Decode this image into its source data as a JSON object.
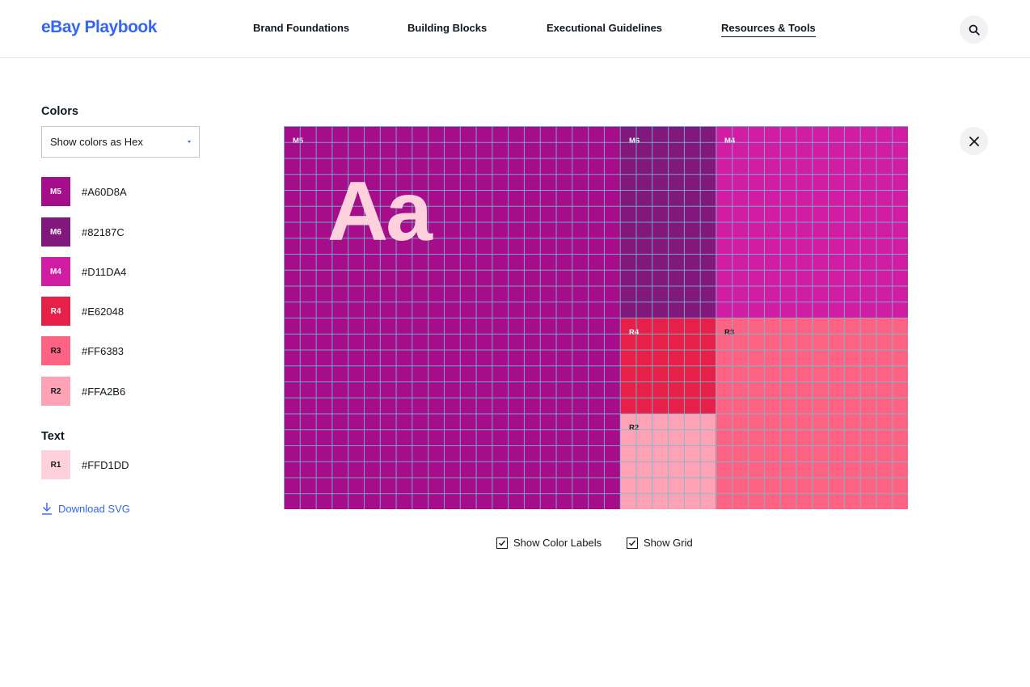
{
  "header": {
    "logo": "eBay Playbook",
    "nav": [
      "Brand Foundations",
      "Building Blocks",
      "Executional Guidelines",
      "Resources & Tools"
    ],
    "active_nav": "Resources & Tools",
    "search_icon": "search-icon"
  },
  "sidebar": {
    "colors_title": "Colors",
    "select_value": "Show colors as Hex",
    "swatches": [
      {
        "code": "M5",
        "hex": "#A60D8A",
        "label_color": "#ffffff"
      },
      {
        "code": "M6",
        "hex": "#82187C",
        "label_color": "#ffffff"
      },
      {
        "code": "M4",
        "hex": "#D11DA4",
        "label_color": "#ffffff"
      },
      {
        "code": "R4",
        "hex": "#E62048",
        "label_color": "#ffffff"
      },
      {
        "code": "R3",
        "hex": "#FF6383",
        "label_color": "#111820"
      },
      {
        "code": "R2",
        "hex": "#FFA2B6",
        "label_color": "#111820"
      }
    ],
    "text_title": "Text",
    "text_swatch": {
      "code": "R1",
      "hex": "#FFD1DD",
      "label_color": "#111820"
    },
    "download_label": "Download SVG"
  },
  "canvas": {
    "sample_text": "Aa",
    "blocks": [
      {
        "label": "M5",
        "color": "#A60D8A",
        "label_color": "#ffffff"
      },
      {
        "label": "M6",
        "color": "#82187C",
        "label_color": "#ffffff"
      },
      {
        "label": "M4",
        "color": "#D11DA4",
        "label_color": "#ffffff"
      },
      {
        "label": "R4",
        "color": "#E62048",
        "label_color": "#ffffff"
      },
      {
        "label": "R3",
        "color": "#FF6383",
        "label_color": "#111820"
      },
      {
        "label": "R2",
        "color": "#FFA2B6",
        "label_color": "#111820"
      }
    ],
    "grid_color": "#6EBED2"
  },
  "options": {
    "show_labels": "Show Color Labels",
    "show_labels_checked": true,
    "show_grid": "Show Grid",
    "show_grid_checked": true
  },
  "colors": {
    "accent": "#3665f3",
    "text": "#111820"
  }
}
